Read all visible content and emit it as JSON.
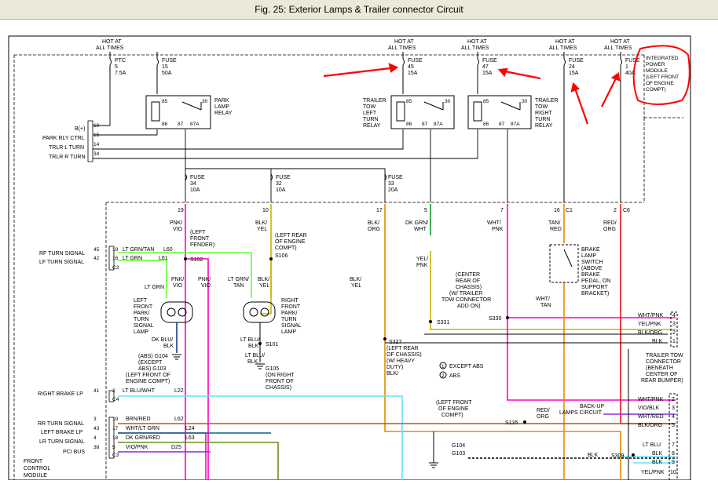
{
  "window": {
    "title": "Fig. 25: Exterior Lamps & Trailer connector Circuit"
  },
  "colors": {
    "pink": "#ff00c8",
    "ltgrn": "#66ff33",
    "ltblu": "#66e0ff",
    "brn": "#c05a00",
    "orange": "#e88a00",
    "dkgrn": "#0a9a2a",
    "purple": "#8a2be2",
    "red": "#e81010",
    "olive": "#6b8e23",
    "annot": "#ff0000"
  },
  "supply": {
    "hot": [
      "HOT AT",
      "ALL TIMES"
    ],
    "fuses": [
      {
        "title": "FUSE",
        "num": "5",
        "amp": "7.5A",
        "type": "PTC"
      },
      {
        "title": "FUSE",
        "num": "15",
        "amp": "50A"
      },
      {
        "title": "FUSE",
        "num": "45",
        "amp": "15A"
      },
      {
        "title": "FUSE",
        "num": "47",
        "amp": "15A"
      },
      {
        "title": "FUSE",
        "num": "24",
        "amp": "15A"
      },
      {
        "title": "FUSE",
        "num": "1",
        "amp": "40A"
      }
    ]
  },
  "relays": {
    "park": [
      "PARK",
      "LAMP",
      "RELAY"
    ],
    "left": [
      "TRAILER",
      "TOW",
      "LEFT",
      "TURN",
      "RELAY"
    ],
    "right": [
      "TRAILER",
      "TOW",
      "RIGHT",
      "TURN",
      "RELAY"
    ],
    "pins": {
      "p85": "85",
      "p30": "30",
      "p86": "86",
      "p87": "87",
      "p87a": "87A"
    }
  },
  "ipm": [
    "INTEGRATED",
    "POWER",
    "MODULE",
    "(LEFT FRONT",
    "OF ENGINE",
    "COMPT)"
  ],
  "fuses2": [
    {
      "title": "FUSE",
      "num": "34",
      "amp": "10A"
    },
    {
      "title": "FUSE",
      "num": "32",
      "amp": "10A"
    },
    {
      "title": "FUSE",
      "num": "33",
      "amp": "20A"
    }
  ],
  "ipm_pins": [
    "19",
    "10",
    "17",
    "5",
    "7",
    "16",
    "C1",
    "2",
    "C6"
  ],
  "fcm_left": [
    {
      "label": "B(+)",
      "pin": "10"
    },
    {
      "label": "PARK RLY CTRL",
      "pin": "15"
    },
    {
      "label": "TRLR L TURN",
      "pin": "14"
    },
    {
      "label": "TRLR R TURN",
      "pin": "34"
    }
  ],
  "fcm": [
    "FRONT",
    "CONTROL",
    "MODULE"
  ],
  "fcm_signals": [
    {
      "label": "RF TURN SIGNAL",
      "pin": "45",
      "pin2": "19",
      "wire": "LT GRN/TAN",
      "circuit": "L60"
    },
    {
      "label": "LF TURN SIGNAL",
      "pin": "42",
      "pin2": "16",
      "wire": "LT GRN",
      "circuit": "L61"
    },
    {
      "label": "RIGHT BRAKE LP",
      "pin": "41",
      "pin2": "2",
      "wire": "LT BLU/WHT",
      "circuit": "L22"
    },
    {
      "label": "RR TURN SIGNAL",
      "pin": "3",
      "pin2": "19",
      "wire": "BRN/RED",
      "circuit": "L62"
    },
    {
      "label": "LEFT BRAKE LP",
      "pin": "43",
      "pin2": "17",
      "wire": "WHT/LT GRN",
      "circuit": "L24"
    },
    {
      "label": "LR TURN SIGNAL",
      "pin": "4",
      "pin2": "18",
      "wire": "DK GRN/RED",
      "circuit": "L63"
    },
    {
      "label": "PCI BUS",
      "pin": "38",
      "pin2": "5",
      "wire": "VIO/PNK",
      "circuit": "D25"
    }
  ],
  "connectors": {
    "c3": "C3",
    "c4": "C4"
  },
  "wires": {
    "pnk_vio": [
      "PNK/",
      "VIO"
    ],
    "blk_yel": [
      "BLK/",
      "YEL"
    ],
    "blk_org": [
      "BLK/",
      "ORG"
    ],
    "dkgrn_wht": [
      "DK GRN/",
      "WHT"
    ],
    "wht_pnk": [
      "WHT/",
      "PNK"
    ],
    "tan_red": [
      "TAN/",
      "RED"
    ],
    "red_org": [
      "RED/",
      "ORG"
    ],
    "yel_pnk": [
      "YEL/",
      "PNK"
    ],
    "ltgrn": [
      "LT GRN"
    ],
    "ltgrn_tan": [
      "LT GRN/",
      "TAN"
    ],
    "dkblu_blk": [
      "DK BLU/",
      "BLK"
    ],
    "ltblu_blk": [
      "LT BLU/",
      "BLK"
    ],
    "wht_tan": [
      "WHT/",
      "TAN"
    ],
    "red_org2": [
      "RED/",
      "ORG"
    ]
  },
  "splices": {
    "s102": "S102",
    "s106": "S106",
    "s101": "S101",
    "s331": "S331",
    "s330": "S330",
    "s327": "S327",
    "s135": "S135",
    "s309": "S309"
  },
  "locations": {
    "left_fender": [
      "(LEFT",
      "FRONT",
      "FENDER)"
    ],
    "left_rear_engine": [
      "(LEFT REAR",
      "OF ENGINE",
      "COMPT)"
    ],
    "center_rear": [
      "(CENTER",
      "REAR OF",
      "CHASSIS)",
      "(W/ TRAILER",
      "TOW CONNECTOR",
      "ADD ON)"
    ],
    "s327_loc": [
      "(LEFT REAR",
      "OF CHASSIS)",
      "(W/ HEAVY",
      "DUTY)"
    ],
    "left_front_engine": [
      "(LEFT FRONT",
      "OF ENGINE",
      "COMPT)"
    ]
  },
  "lamps": {
    "left": [
      "LEFT",
      "FRONT",
      "PARK/",
      "TURN",
      "SIGNAL",
      "LAMP"
    ],
    "right": [
      "RIGHT",
      "FRONT",
      "PARK/",
      "TURN",
      "SIGNAL",
      "LAMP"
    ]
  },
  "grounds": {
    "g104a": [
      "(ABS) G104",
      "(EXCEPT",
      "ABS) G103",
      "(LEFT FRONT OF",
      "ENGINE COMPT)"
    ],
    "g105": [
      "G105",
      "(ON RIGHT",
      "FRONT OF",
      "CHASSIS)"
    ],
    "g104b": "G104",
    "g103": "G103",
    "legend1": "EXCEPT ABS",
    "legend2": "ABS"
  },
  "brake_switch": [
    "BRAKE",
    "LAMP",
    "SWITCH",
    "(ABOVE",
    "BRAKE",
    "PEDAL, ON",
    "SUPPORT",
    "BRACKET)"
  ],
  "trailer": {
    "title": [
      "TRAILER TOW",
      "CONNECTOR",
      "(BENEATH",
      "CENTER OF",
      "REAR BUMPER)"
    ],
    "pins": [
      {
        "wire": "WHT/PNK",
        "pin": "4"
      },
      {
        "wire": "YEL/PNK",
        "pin": "3"
      },
      {
        "wire": "BLK/ORG",
        "pin": "2"
      },
      {
        "wire": "BLK",
        "pin": "1"
      }
    ],
    "pins2": [
      {
        "wire": "WHT/PNK",
        "pin": "2"
      },
      {
        "wire": "VIO/BLK",
        "pin": "3"
      },
      {
        "wire": "WHT/RED",
        "pin": "4"
      },
      {
        "wire": "BLK/ORG",
        "pin": "5"
      },
      {
        "wire": "LT BLU",
        "pin": "7"
      },
      {
        "wire": "BLK",
        "pin": "8"
      },
      {
        "wire": "BLK",
        "pin": "9"
      },
      {
        "wire": "YEL/PNK",
        "pin": "10"
      }
    ],
    "backup": [
      "BACK-UP",
      "LAMPS CIRCUIT"
    ],
    "red_org": [
      "RED/",
      "ORG"
    ],
    "blk": "BLK"
  }
}
